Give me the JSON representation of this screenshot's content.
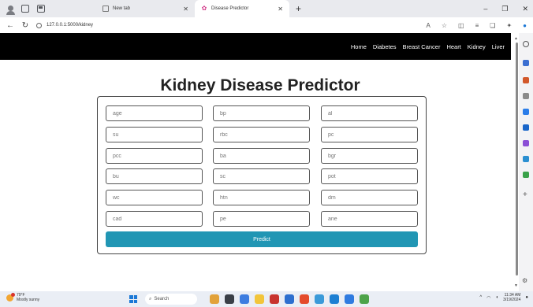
{
  "browser": {
    "tabs": [
      {
        "title": "New tab",
        "active": false
      },
      {
        "title": "Disease Predictor",
        "active": true
      }
    ],
    "address": "127.0.0.1:5000/kidney"
  },
  "nav": {
    "links": [
      "Home",
      "Diabetes",
      "Breast Cancer",
      "Heart",
      "Kidney",
      "Liver"
    ]
  },
  "page": {
    "title": "Kidney Disease Predictor",
    "fields": [
      "age",
      "bp",
      "al",
      "su",
      "rbc",
      "pc",
      "pcc",
      "ba",
      "bgr",
      "bu",
      "sc",
      "pot",
      "wc",
      "htn",
      "dm",
      "cad",
      "pe",
      "ane"
    ],
    "submit_label": "Predict"
  },
  "taskbar": {
    "weather_temp": "79°F",
    "weather_desc": "Mostly sunny",
    "search_placeholder": "Search",
    "time": "11:34 AM",
    "date": "3/19/2024"
  },
  "colors": {
    "nav_bg": "#000000",
    "button_bg": "#2196b4"
  }
}
